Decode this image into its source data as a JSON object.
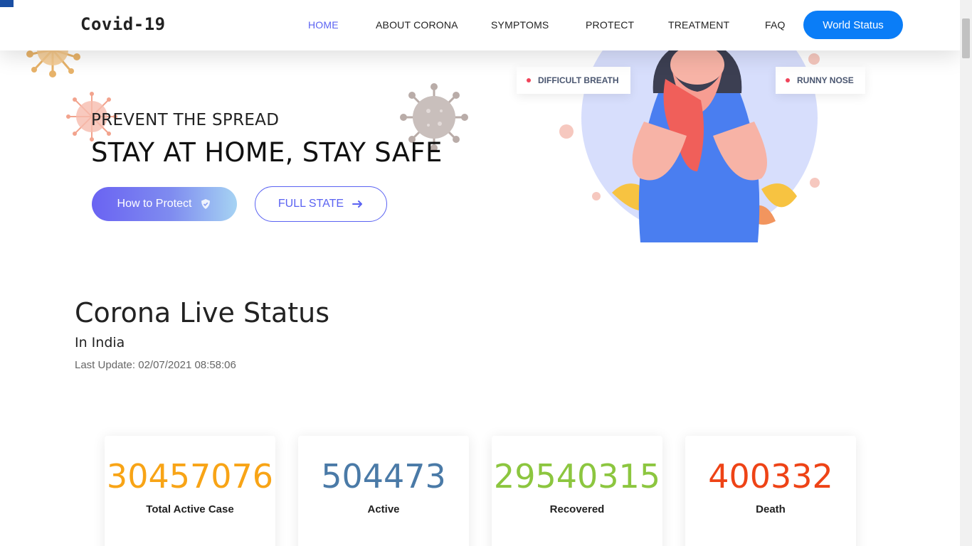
{
  "nav": {
    "brand": "Covid-19",
    "items": [
      {
        "label": "HOME",
        "active": true
      },
      {
        "label": "ABOUT CORONA"
      },
      {
        "label": "SYMPTOMS"
      },
      {
        "label": "PROTECT"
      },
      {
        "label": "TREATMENT"
      },
      {
        "label": "FAQ"
      }
    ],
    "cta_label": "World Status"
  },
  "hero": {
    "kicker": "PREVENT THE SPREAD",
    "title": "STAY AT HOME, STAY SAFE",
    "protect_button": "How to Protect",
    "full_state_button": "FULL STATE",
    "symptom_tags": [
      "DIFFICULT BREATH",
      "RUNNY NOSE"
    ]
  },
  "live": {
    "title": "Corona Live Status",
    "country": "In India",
    "last_update": "Last Update: 02/07/2021 08:58:06"
  },
  "stats": [
    {
      "value": "30457076",
      "label": "Total Active Case",
      "color": "#f8a416"
    },
    {
      "value": "504473",
      "label": "Active",
      "color": "#4a7aa7"
    },
    {
      "value": "29540315",
      "label": "Recovered",
      "color": "#8cc63f"
    },
    {
      "value": "400332",
      "label": "Death",
      "color": "#ee4316"
    }
  ],
  "colors": {
    "accent": "#5b63f2",
    "cta": "#0a7df7"
  },
  "icons": [
    "shield-icon",
    "arrow-right-icon",
    "virus-icon"
  ]
}
